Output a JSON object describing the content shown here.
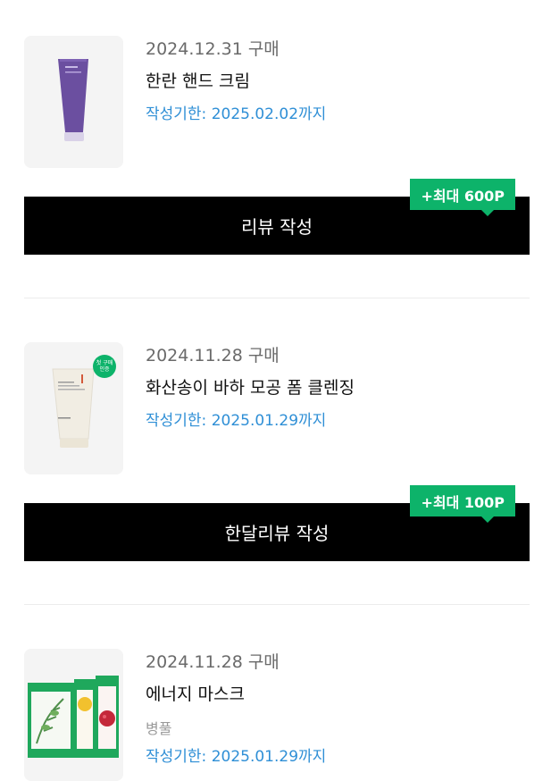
{
  "orders": [
    {
      "date": "2024.12.31 구매",
      "product_name": "한란 핸드 크림",
      "option": "",
      "deadline": "작성기한: 2025.02.02까지",
      "button_label": "리뷰 작성",
      "badge": "+최대 600P"
    },
    {
      "date": "2024.11.28 구매",
      "product_name": "화산송이 바하 모공 폼 클렌징",
      "option": "",
      "deadline": "작성기한: 2025.01.29까지",
      "button_label": "한달리뷰 작성",
      "badge": "+최대 100P",
      "thumb_badge": "첫 구매 인증"
    },
    {
      "date": "2024.11.28 구매",
      "product_name": "에너지 마스크",
      "option": "병풀",
      "deadline": "작성기한: 2025.01.29까지"
    }
  ],
  "colors": {
    "accent_green": "#0db36a",
    "deadline_blue": "#2f8fd6",
    "button_black": "#000000"
  }
}
